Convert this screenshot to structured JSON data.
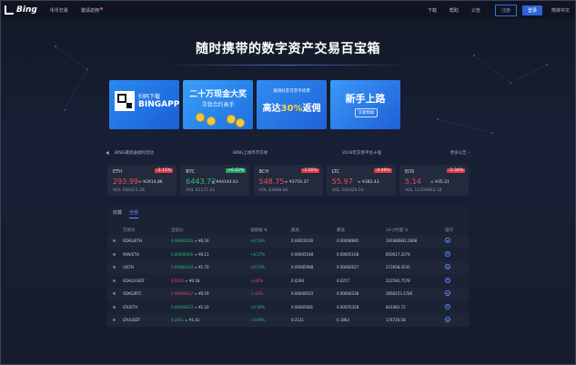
{
  "nav": {
    "logo_text": "Bing",
    "links": [
      "币币交易",
      "邀请返佣"
    ],
    "right_links": [
      "下载",
      "帮助",
      "公告"
    ],
    "register": "注册",
    "login": "登录",
    "language": "简体中文"
  },
  "hero": {
    "title": "随时携带的数字资产交易百宝箱"
  },
  "banners": {
    "b1_line1": "扫码下载",
    "b1_line2": "BINGAPP",
    "b2_line1": "二十万现金大奖",
    "b2_line2": "寻我合约高手",
    "b3_line1": "邀请好友可获手续费",
    "b3_pre": "高达",
    "b3_hl": "30%",
    "b3_post": "返佣",
    "b4_line1": "新手上路",
    "b4_line2": "交易帮助"
  },
  "announcements": {
    "item1": "BING邀请送福利活动",
    "item2": "BING上线币币交易",
    "item3": "2019年交易平台十强",
    "more": "更多公告"
  },
  "tickers": [
    {
      "symbol": "ETH",
      "change": "-2.15%",
      "price": "293.99",
      "cny": "≈ ¥2914.86",
      "vol": "VOL  569421.28",
      "dir": "down"
    },
    {
      "symbol": "BTC",
      "change": "+0.62%",
      "price": "6443.72",
      "cny": "≈ ¥44144.63",
      "vol": "VOL  81171.62",
      "dir": "up"
    },
    {
      "symbol": "BCH",
      "change": "-3.56%",
      "price": "548.75",
      "cny": "≈ ¥3759.37",
      "vol": "VOL  43898.86",
      "dir": "down"
    },
    {
      "symbol": "LTC",
      "change": "-4.09%",
      "price": "55.97",
      "cny": "≈ ¥383.43",
      "vol": "VOL  540329.50",
      "dir": "down"
    },
    {
      "symbol": "EOS",
      "change": "-2.34%",
      "price": "5.14",
      "cny": "≈ ¥35.21",
      "vol": "VOL  11350903.18",
      "dir": "down"
    }
  ],
  "market": {
    "tabs": [
      "收藏",
      "全部"
    ],
    "headers": {
      "pair": "交易对",
      "price": "当前价",
      "chg": "涨跌幅",
      "high": "最高",
      "low": "最低",
      "vol": "24小时量",
      "op": "操作"
    },
    "rows": [
      {
        "pair": "XDAG/ETH",
        "price": "0.00000326",
        "cny": "≈ ¥0.16",
        "chg": "+4.54%",
        "high": "0.00010100",
        "low": "0.00008895",
        "vol": "191680842.2848",
        "dir": "up"
      },
      {
        "pair": "RVN/ETH",
        "price": "0.00006426",
        "cny": "≈ ¥0.11",
        "chg": "+8.57%",
        "high": "0.00005548",
        "low": "0.00005168",
        "vol": "850617.2074",
        "dir": "up"
      },
      {
        "pair": "U/ETH",
        "price": "0.00084424",
        "cny": "≈ ¥1.72",
        "chg": "+0.53%",
        "high": "0.00085988",
        "low": "0.00082627",
        "vol": "272658.4535",
        "dir": "up"
      },
      {
        "pair": "XDAG/USDT",
        "price": "0.0256",
        "cny": "≈ ¥0.18",
        "chg": "-3.42%",
        "high": "0.0294",
        "low": "0.0257",
        "vol": "222592.7578",
        "dir": "down"
      },
      {
        "pair": "XDAG/BTC",
        "price": "0.00000417",
        "cny": "≈ ¥0.19",
        "chg": "-1.42%",
        "high": "0.00000503",
        "low": "0.00000338",
        "vol": "2666153.1780",
        "dir": "down"
      },
      {
        "pair": "LTK/ETH",
        "price": "0.00054023",
        "cny": "≈ ¥1.10",
        "chg": "+0.56%",
        "high": "0.00065081",
        "low": "0.00055358",
        "vol": "841482.72",
        "dir": "up"
      },
      {
        "pair": "LTK/USDT",
        "price": "0.2041",
        "cny": "≈ ¥1.41",
        "chg": "+0.95%",
        "high": "0.2121",
        "low": "0.1863",
        "vol": "174726.58",
        "dir": "up"
      }
    ]
  }
}
